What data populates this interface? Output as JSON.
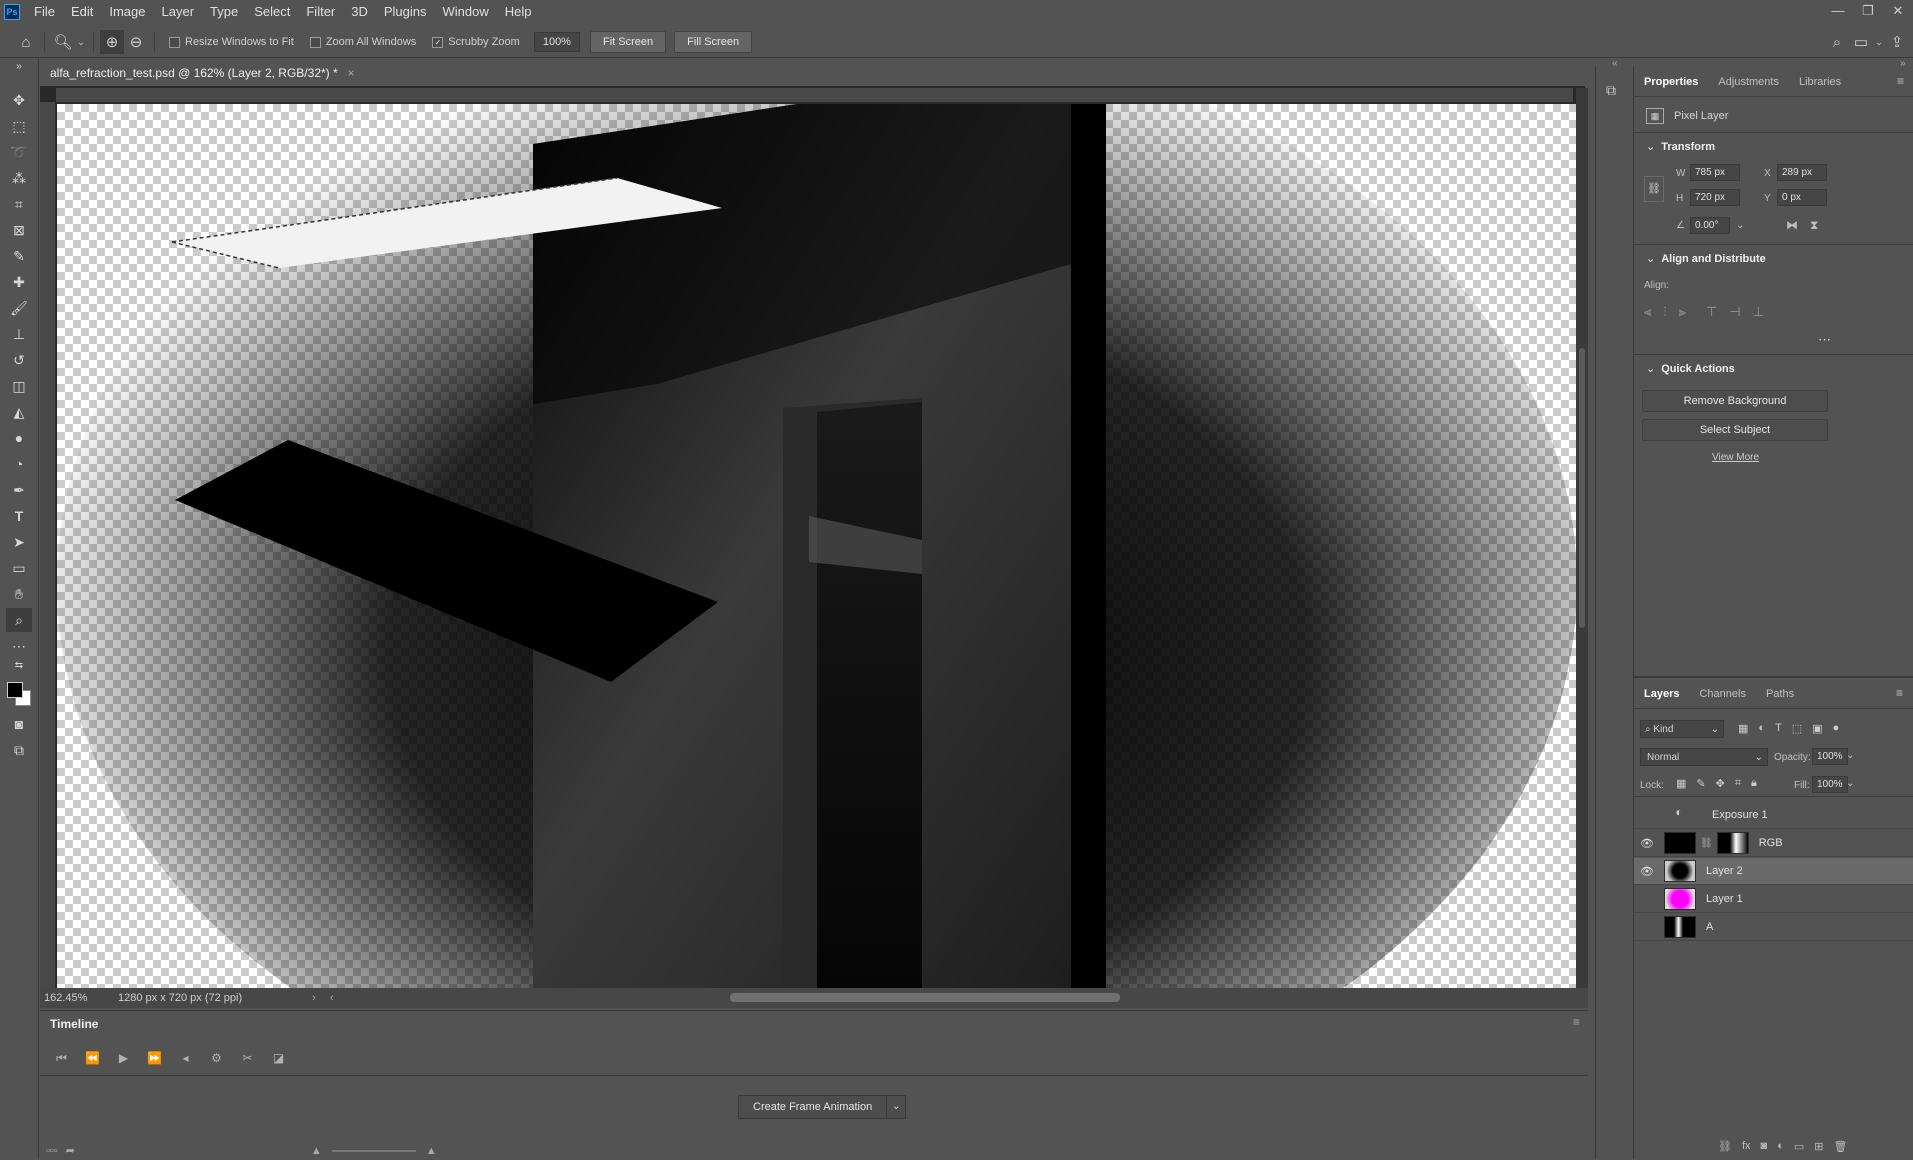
{
  "app": {
    "logo": "Ps"
  },
  "menu": [
    "File",
    "Edit",
    "Image",
    "Layer",
    "Type",
    "Select",
    "Filter",
    "3D",
    "Plugins",
    "Window",
    "Help"
  ],
  "window_controls": {
    "minimize": "—",
    "restore": "❐",
    "close": "✕"
  },
  "options": {
    "resize_windows": "Resize Windows to Fit",
    "zoom_all": "Zoom All Windows",
    "scrubby_zoom": "Scrubby Zoom",
    "scrubby_checked": true,
    "zoom_value": "100%",
    "fit_screen": "Fit Screen",
    "fill_screen": "Fill Screen"
  },
  "document": {
    "tab_title": "alfa_refraction_test.psd @ 162% (Layer 2, RGB/32*) *",
    "close": "×",
    "zoom": "162.45%",
    "info": "1280 px x 720 px (72 ppi)"
  },
  "timeline": {
    "title": "Timeline",
    "create_button": "Create Frame Animation"
  },
  "properties": {
    "tabs": [
      "Properties",
      "Adjustments",
      "Libraries"
    ],
    "layer_type": "Pixel Layer",
    "transform_title": "Transform",
    "w_label": "W",
    "w": "785 px",
    "h_label": "H",
    "h": "720 px",
    "x_label": "X",
    "x": "289 px",
    "y_label": "Y",
    "y": "0 px",
    "angle": "0.00°",
    "align_title": "Align and Distribute",
    "align_label": "Align:",
    "quick_actions_title": "Quick Actions",
    "remove_bg": "Remove Background",
    "select_subject": "Select Subject",
    "view_more": "View More"
  },
  "layers_panel": {
    "tabs": [
      "Layers",
      "Channels",
      "Paths"
    ],
    "kind": "Kind",
    "blend_mode": "Normal",
    "opacity_label": "Opacity:",
    "opacity": "100%",
    "lock_label": "Lock:",
    "fill_label": "Fill:",
    "fill": "100%",
    "layers": [
      {
        "name": "Exposure 1",
        "visible": false
      },
      {
        "name": "RGB",
        "visible": true
      },
      {
        "name": "Layer 2",
        "visible": true,
        "selected": true
      },
      {
        "name": "Layer 1",
        "visible": false
      },
      {
        "name": "A",
        "visible": false
      }
    ]
  },
  "colors": {
    "accent": "#31a8ff",
    "layer1_thumb": "#ff00ff"
  }
}
